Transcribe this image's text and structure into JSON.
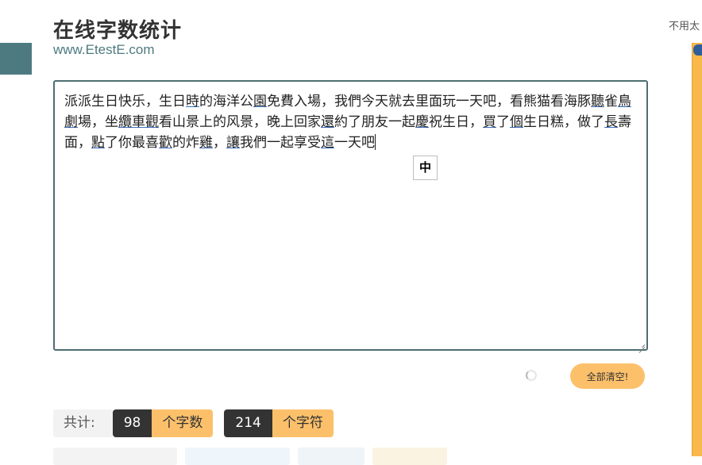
{
  "page": {
    "title": "在线字数统计",
    "site_url": "www.EtestE.com",
    "top_right_note": "不用太"
  },
  "editor": {
    "segments": [
      {
        "t": "派派生日快乐，生日"
      },
      {
        "t": "時",
        "u": true
      },
      {
        "t": "的海洋公"
      },
      {
        "t": "園",
        "u": true
      },
      {
        "t": "免費入場，我們今天就去里面玩一天吧，看熊猫看海豚"
      },
      {
        "t": "聽",
        "u": true
      },
      {
        "t": "雀"
      },
      {
        "t": "鳥劇",
        "u": true
      },
      {
        "t": "場，坐"
      },
      {
        "t": "纜車觀",
        "u": true
      },
      {
        "t": "看山景上的风景，晚上回家"
      },
      {
        "t": "還",
        "u": true
      },
      {
        "t": "約了朋友一起"
      },
      {
        "t": "慶",
        "u": true
      },
      {
        "t": "祝生日，"
      },
      {
        "t": "買",
        "u": true
      },
      {
        "t": "了"
      },
      {
        "t": "個",
        "u": true
      },
      {
        "t": "生日糕，做了"
      },
      {
        "t": "長",
        "u": true
      },
      {
        "t": "壽面，"
      },
      {
        "t": "點",
        "u": true
      },
      {
        "t": "了你最喜"
      },
      {
        "t": "歡",
        "u": true
      },
      {
        "t": "的炸"
      },
      {
        "t": "雞",
        "u": true
      },
      {
        "t": "，"
      },
      {
        "t": "讓",
        "u": true
      },
      {
        "t": "我們一起享受"
      },
      {
        "t": "這",
        "u": true
      },
      {
        "t": "一天吧"
      }
    ],
    "ime_mode": "中"
  },
  "actions": {
    "clear_label": "全部清空!"
  },
  "stats": {
    "total_label": "共计:",
    "chars_count": "98",
    "chars_unit": "个字数",
    "symbols_count": "214",
    "symbols_unit": "个字符"
  }
}
